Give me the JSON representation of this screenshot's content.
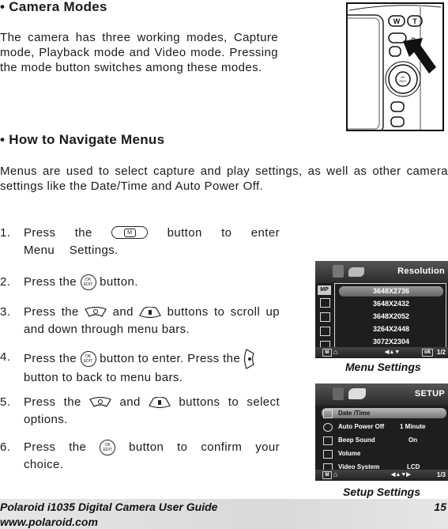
{
  "section1": {
    "heading": "• Camera Modes",
    "body": "The camera has three working modes, Capture mode, Playback mode and Video mode. Pressing the mode button switches among these modes."
  },
  "section2": {
    "heading": "• How to Navigate Menus",
    "body": "Menus are used to select capture and play settings, as well as other camera settings like the Date/Time and Auto Power Off."
  },
  "steps": [
    {
      "num": "1.",
      "pre": "Press the",
      "icon": "menu-button-icon",
      "post": "button to enter Menu Settings."
    },
    {
      "num": "2.",
      "pre": "Press the",
      "icon": "ok-edit-button-icon",
      "post": "button."
    },
    {
      "num": "3.",
      "pre": "Press the",
      "icon": "up-button-icon",
      "mid": "and",
      "icon2": "down-button-icon",
      "post": "buttons to scroll up and down through menu bars."
    },
    {
      "num": "4.",
      "pre": "Press the",
      "icon": "ok-edit-button-icon",
      "mid": "button to enter. Press the",
      "icon2": "left-button-icon",
      "post": "button to back to menu bars."
    },
    {
      "num": "5.",
      "pre": "Press the",
      "icon": "up-button-icon",
      "mid": "and",
      "icon2": "down-button-icon",
      "post": "buttons to select options."
    },
    {
      "num": "6.",
      "pre": "Press the",
      "icon": "ok-edit-button-icon",
      "post": "button to confirm your choice."
    }
  ],
  "icons": {
    "menu_label": "M",
    "ok_top": "OK",
    "ok_bottom": "EDIT"
  },
  "camera_image": {
    "zoom_w": "W",
    "zoom_t": "T",
    "ok_top": "OK",
    "ok_bottom": "EDIT"
  },
  "menu_screen": {
    "title": "Resolution",
    "items": [
      "3648X2736",
      "3648X2432",
      "3648X2052",
      "3264X2448",
      "3072X2304"
    ],
    "selected_index": 0,
    "side_icons": [
      "MP",
      "",
      "",
      "",
      ""
    ],
    "footer_left": "M",
    "footer_nav": "◀▲▼",
    "footer_ok": "ok",
    "footer_page": "1/2",
    "caption": "Menu Settings"
  },
  "setup_screen": {
    "title": "SETUP",
    "rows": [
      {
        "label": "Date /Time",
        "value": ""
      },
      {
        "label": "Auto Power Off",
        "value": "1 Minute"
      },
      {
        "label": "Beep Sound",
        "value": "On"
      },
      {
        "label": "Volume",
        "value": ""
      },
      {
        "label": "Video System",
        "value": "LCD"
      }
    ],
    "selected_index": 0,
    "footer_left": "M",
    "footer_nav": "◀▲▼▶",
    "footer_page": "1/3",
    "caption": "Setup Settings"
  },
  "footer": {
    "title": "Polaroid i1035 Digital Camera User Guide",
    "url": "www.polaroid.com",
    "page_number": "15"
  }
}
